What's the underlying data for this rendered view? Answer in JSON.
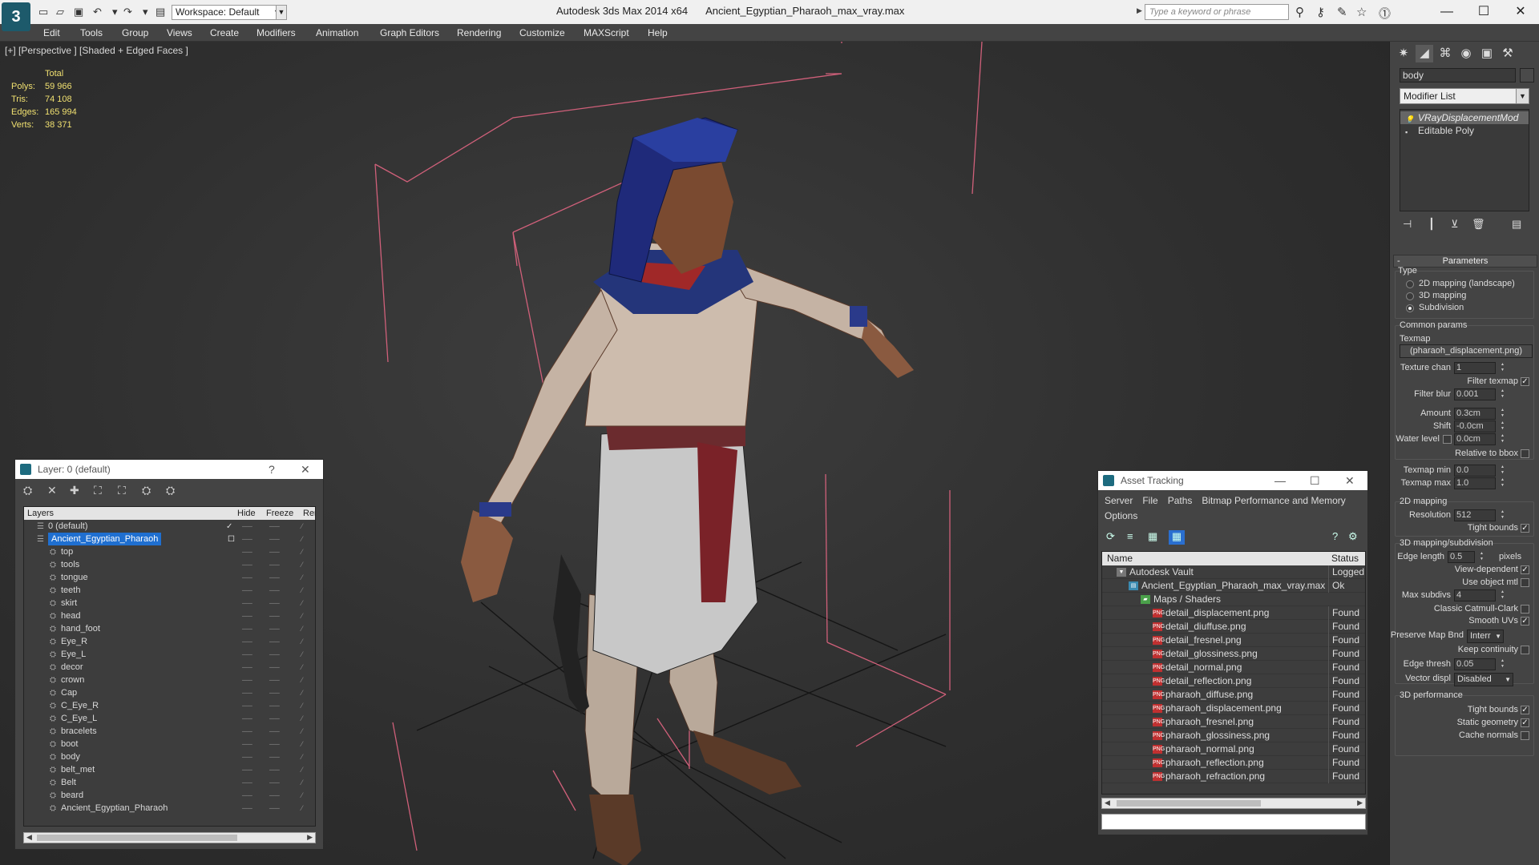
{
  "titlebar": {
    "workspace": "Workspace: Default",
    "app_name": "Autodesk 3ds Max  2014 x64",
    "file_name": "Ancient_Egyptian_Pharaoh_max_vray.max",
    "search_placeholder": "Type a keyword or phrase"
  },
  "menu": [
    "Edit",
    "Tools",
    "Group",
    "Views",
    "Create",
    "Modifiers",
    "Animation",
    "Graph Editors",
    "Rendering",
    "Customize",
    "MAXScript",
    "Help"
  ],
  "viewport": {
    "label": "[+] [Perspective ] [Shaded + Edged Faces ]",
    "stats": {
      "header": "Total",
      "rows": [
        {
          "k": "Polys:",
          "v": "59 966"
        },
        {
          "k": "Tris:",
          "v": "74 108"
        },
        {
          "k": "Edges:",
          "v": "165 994"
        },
        {
          "k": "Verts:",
          "v": "38 371"
        }
      ]
    }
  },
  "layer_panel": {
    "title": "Layer: 0 (default)",
    "help": "?",
    "close": "✕",
    "columns": [
      "Layers",
      "Hide",
      "Freeze",
      "Rer"
    ],
    "rows": [
      {
        "name": "0 (default)",
        "level": 0,
        "check": "✓"
      },
      {
        "name": "Ancient_Egyptian_Pharaoh",
        "level": 0,
        "selected": true
      },
      {
        "name": "top",
        "level": 1
      },
      {
        "name": "tools",
        "level": 1
      },
      {
        "name": "tongue",
        "level": 1
      },
      {
        "name": "teeth",
        "level": 1
      },
      {
        "name": "skirt",
        "level": 1
      },
      {
        "name": "head",
        "level": 1
      },
      {
        "name": "hand_foot",
        "level": 1
      },
      {
        "name": "Eye_R",
        "level": 1
      },
      {
        "name": "Eye_L",
        "level": 1
      },
      {
        "name": "decor",
        "level": 1
      },
      {
        "name": "crown",
        "level": 1
      },
      {
        "name": "Cap",
        "level": 1
      },
      {
        "name": "C_Eye_R",
        "level": 1
      },
      {
        "name": "C_Eye_L",
        "level": 1
      },
      {
        "name": "bracelets",
        "level": 1
      },
      {
        "name": "boot",
        "level": 1
      },
      {
        "name": "body",
        "level": 1
      },
      {
        "name": "belt_met",
        "level": 1
      },
      {
        "name": "Belt",
        "level": 1
      },
      {
        "name": "beard",
        "level": 1
      },
      {
        "name": "Ancient_Egyptian_Pharaoh",
        "level": 1
      }
    ]
  },
  "asset_panel": {
    "title": "Asset Tracking",
    "menu": [
      "Server",
      "File",
      "Paths",
      "Bitmap Performance and Memory",
      "Options"
    ],
    "columns": [
      "Name",
      "Status"
    ],
    "rows": [
      {
        "name": "Autodesk Vault",
        "status": "Logged C",
        "level": 0,
        "icon": "vault"
      },
      {
        "name": "Ancient_Egyptian_Pharaoh_max_vray.max",
        "status": "Ok",
        "level": 1,
        "icon": "max"
      },
      {
        "name": "Maps / Shaders",
        "status": "",
        "level": 2,
        "icon": "maps"
      },
      {
        "name": "detail_displacement.png",
        "status": "Found",
        "level": 3,
        "icon": "png"
      },
      {
        "name": "detail_diuffuse.png",
        "status": "Found",
        "level": 3,
        "icon": "png"
      },
      {
        "name": "detail_fresnel.png",
        "status": "Found",
        "level": 3,
        "icon": "png"
      },
      {
        "name": "detail_glossiness.png",
        "status": "Found",
        "level": 3,
        "icon": "png"
      },
      {
        "name": "detail_normal.png",
        "status": "Found",
        "level": 3,
        "icon": "png"
      },
      {
        "name": "detail_reflection.png",
        "status": "Found",
        "level": 3,
        "icon": "png"
      },
      {
        "name": "pharaoh_diffuse.png",
        "status": "Found",
        "level": 3,
        "icon": "png"
      },
      {
        "name": "pharaoh_displacement.png",
        "status": "Found",
        "level": 3,
        "icon": "png"
      },
      {
        "name": "pharaoh_fresnel.png",
        "status": "Found",
        "level": 3,
        "icon": "png"
      },
      {
        "name": "pharaoh_glossiness.png",
        "status": "Found",
        "level": 3,
        "icon": "png"
      },
      {
        "name": "pharaoh_normal.png",
        "status": "Found",
        "level": 3,
        "icon": "png"
      },
      {
        "name": "pharaoh_reflection.png",
        "status": "Found",
        "level": 3,
        "icon": "png"
      },
      {
        "name": "pharaoh_refraction.png",
        "status": "Found",
        "level": 3,
        "icon": "png"
      }
    ]
  },
  "command_panel": {
    "object_name": "body",
    "modifier_list": "Modifier List",
    "stack": [
      "VRayDisplacementMod",
      "Editable Poly"
    ],
    "rollup_parameters": "Parameters",
    "type_label": "Type",
    "type_options": [
      "2D mapping (landscape)",
      "3D mapping",
      "Subdivision"
    ],
    "common_params": "Common params",
    "texmap_label": "Texmap",
    "texmap_button": "(pharaoh_displacement.png)",
    "texture_chan_label": "Texture chan",
    "texture_chan": "1",
    "filter_texmap": "Filter texmap",
    "filter_blur_label": "Filter blur",
    "filter_blur": "0.001",
    "amount_label": "Amount",
    "amount": "0.3cm",
    "shift_label": "Shift",
    "shift": "-0.0cm",
    "water_level_label": "Water level",
    "water_level": "0.0cm",
    "relative_bbox": "Relative to bbox",
    "texmap_min_label": "Texmap min",
    "texmap_min": "0.0",
    "texmap_max_label": "Texmap max",
    "texmap_max": "1.0",
    "mapping2d": "2D mapping",
    "resolution_label": "Resolution",
    "resolution": "512",
    "tight_bounds": "Tight bounds",
    "mapping3d": "3D mapping/subdivision",
    "edge_length_label": "Edge length",
    "edge_length": "0.5",
    "pixels": "pixels",
    "view_dependent": "View-dependent",
    "use_object_mtl": "Use object mtl",
    "max_subdivs_label": "Max subdivs",
    "max_subdivs": "4",
    "classic_catmull": "Classic Catmull-Clark",
    "smooth_uvs": "Smooth UVs",
    "preserve_map_label": "Preserve Map Bnd",
    "preserve_map": "Interr",
    "keep_continuity": "Keep continuity",
    "edge_thresh_label": "Edge thresh",
    "edge_thresh": "0.05",
    "vector_displ_label": "Vector displ",
    "vector_displ": "Disabled",
    "perf3d": "3D performance",
    "tight_bounds2": "Tight bounds",
    "static_geometry": "Static geometry",
    "cache_normals": "Cache normals"
  },
  "colors": {
    "bbox_lines": "#d0607a",
    "selection": "#1f6fd0",
    "stats_text": "#f0e070"
  }
}
